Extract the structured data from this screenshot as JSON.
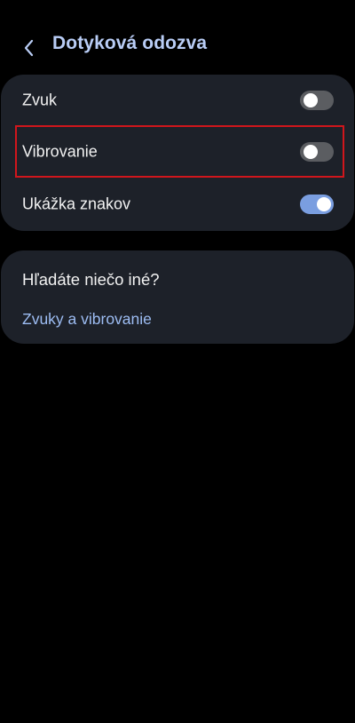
{
  "header": {
    "title": "Dotyková odozva",
    "back_icon": "chevron-left-icon"
  },
  "settings": {
    "items": [
      {
        "label": "Zvuk",
        "enabled": false
      },
      {
        "label": "Vibrovanie",
        "enabled": false,
        "highlighted": true
      },
      {
        "label": "Ukážka znakov",
        "enabled": true
      }
    ]
  },
  "suggestions": {
    "title": "Hľadáte niečo iné?",
    "link": "Zvuky a vibrovanie"
  },
  "colors": {
    "background": "#000000",
    "card": "#1d2129",
    "title_accent": "#b9cdf6",
    "link": "#9dbdf3",
    "switch_on": "#7a9ee0",
    "switch_off": "#5b5d61",
    "highlight": "#d0161c"
  }
}
